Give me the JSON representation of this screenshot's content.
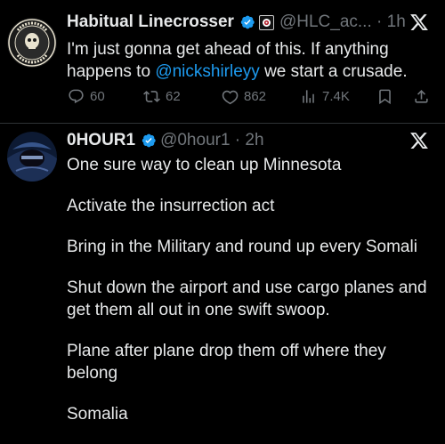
{
  "tweet1": {
    "display_name": "Habitual Linecrosser",
    "handle": "@HLC_ac...",
    "time": "1h",
    "text_before": "I'm just gonna get ahead of this. If anything happens to ",
    "mention": "@nickshirleyy",
    "text_after": " we start a crusade.",
    "stats": {
      "replies": "60",
      "reposts": "62",
      "likes": "862",
      "views": "7.4K"
    },
    "avatar_text": "CROSSER · HABITUAL · LINE"
  },
  "tweet2": {
    "display_name": "0HOUR1",
    "handle": "@0hour1",
    "time": "2h",
    "paragraphs": [
      "One sure way to clean up Minnesota",
      "Activate the insurrection act",
      "Bring in the Military and round up every Somali",
      "Shut down the airport and use cargo planes and get them all out in one swift swoop.",
      "Plane after plane drop them off where they belong",
      "Somalia"
    ]
  },
  "colors": {
    "background": "#000000",
    "text": "#e7e9ea",
    "muted": "#71767b",
    "link": "#1d9bf0",
    "verified": "#1d9bf0"
  },
  "icons": [
    "verified-icon",
    "x-logo-icon",
    "reply-icon",
    "repost-icon",
    "like-icon",
    "views-icon",
    "bookmark-icon",
    "share-icon",
    "affiliate-badge-icon"
  ]
}
